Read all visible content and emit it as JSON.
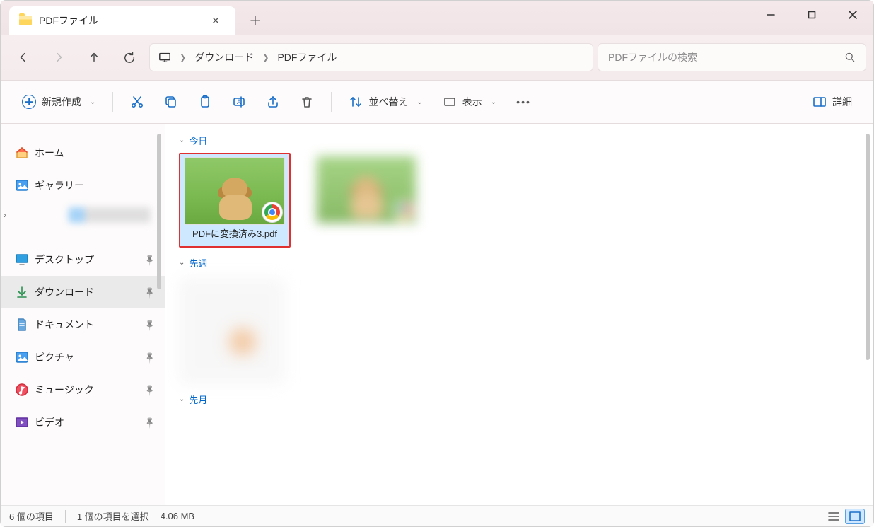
{
  "tab": {
    "title": "PDFファイル"
  },
  "breadcrumb": {
    "seg1": "ダウンロード",
    "seg2": "PDFファイル"
  },
  "search": {
    "placeholder": "PDFファイルの検索"
  },
  "toolbar": {
    "new": "新規作成",
    "sort": "並べ替え",
    "view": "表示",
    "details": "詳細"
  },
  "sidebar": {
    "home": "ホーム",
    "gallery": "ギャラリー",
    "desktop": "デスクトップ",
    "downloads": "ダウンロード",
    "documents": "ドキュメント",
    "pictures": "ピクチャ",
    "music": "ミュージック",
    "videos": "ビデオ"
  },
  "groups": {
    "today": "今日",
    "lastweek": "先週",
    "lastmonth": "先月"
  },
  "files": {
    "selected": {
      "name": "PDFに変換済み3.pdf"
    }
  },
  "status": {
    "count": "6 個の項目",
    "selected": "1 個の項目を選択",
    "size": "4.06 MB"
  }
}
